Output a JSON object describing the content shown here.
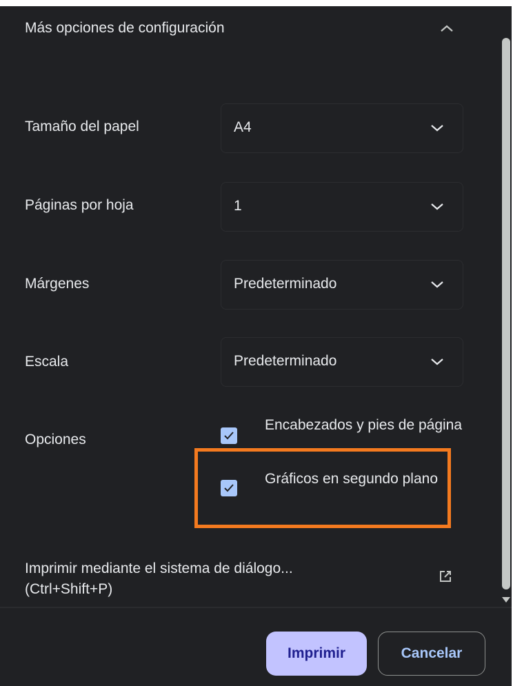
{
  "section": {
    "title": "Más opciones de configuración"
  },
  "settings": [
    {
      "label": "Tamaño del papel",
      "value": "A4"
    },
    {
      "label": "Páginas por hoja",
      "value": "1"
    },
    {
      "label": "Márgenes",
      "value": "Predeterminado"
    },
    {
      "label": "Escala",
      "value": "Predeterminado"
    }
  ],
  "options": {
    "label": "Opciones",
    "items": [
      {
        "label": "Encabezados y pies de página",
        "checked": true
      },
      {
        "label": "Gráficos en segundo plano",
        "checked": true
      }
    ]
  },
  "system_dialog": {
    "label": "Imprimir mediante el sistema de diálogo...",
    "shortcut": "(Ctrl+Shift+P)"
  },
  "buttons": {
    "print": "Imprimir",
    "cancel": "Cancelar"
  },
  "icons": {
    "collapse": "chevron-up-icon",
    "dropdown": "chevron-down-icon",
    "check": "checkmark-icon",
    "external": "open-in-new-icon"
  },
  "colors": {
    "background": "#202124",
    "text": "#e8eaed",
    "checkbox": "#a8c7fa",
    "primary_button": "#c2c3ff",
    "highlight": "#f47a1f"
  }
}
